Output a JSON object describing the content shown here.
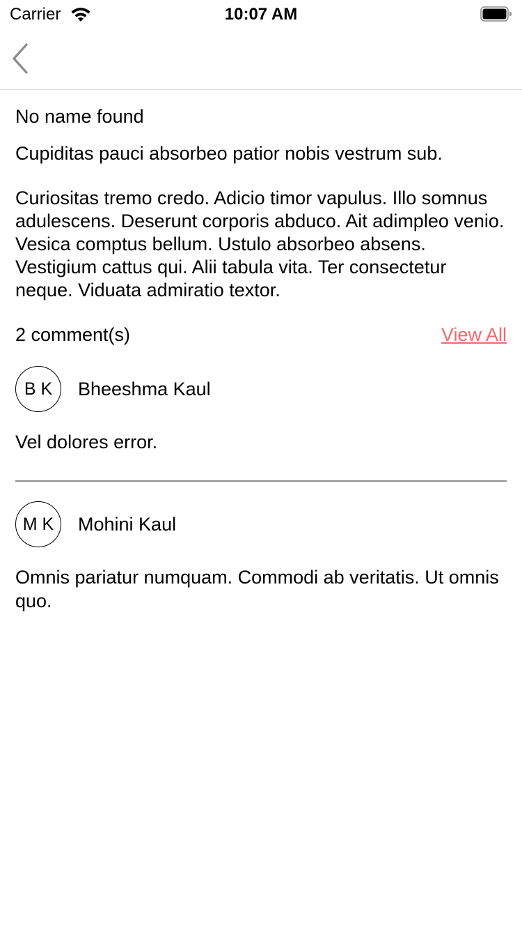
{
  "status_bar": {
    "carrier": "Carrier",
    "time": "10:07 AM"
  },
  "nav": {
    "back_icon": "chevron-left-icon"
  },
  "post": {
    "author": "No name found",
    "title": "Cupiditas pauci absorbeo patior nobis vestrum sub.",
    "body": "Curiositas tremo credo. Adicio timor vapulus. Illo somnus adulescens. Deserunt corporis abduco. Ait adimpleo venio. Vesica comptus bellum. Ustulo absorbeo absens. Vestigium cattus qui. Alii tabula vita. Ter consectetur neque. Viduata admiratio textor."
  },
  "comments": {
    "count_label": "2 comment(s)",
    "view_all_label": "View All",
    "link_color": "#f26b6b",
    "items": [
      {
        "initials": "B K",
        "author": "Bheeshma Kaul",
        "text": "Vel dolores error."
      },
      {
        "initials": "M K",
        "author": "Mohini Kaul",
        "text": "Omnis pariatur numquam. Commodi ab veritatis. Ut omnis quo."
      }
    ]
  }
}
